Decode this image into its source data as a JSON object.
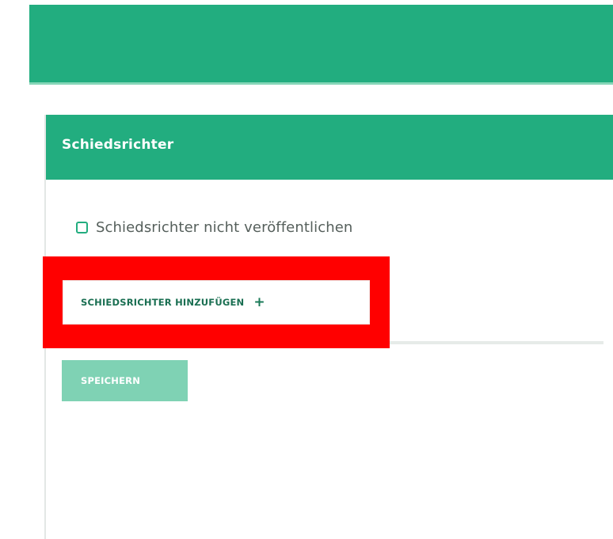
{
  "panel": {
    "title": "Schiedsrichter",
    "checkbox": {
      "label": "Schiedsrichter nicht veröffentlichen",
      "checked": false
    },
    "add_button": {
      "label": "SCHIEDSRICHTER HINZUFÜGEN",
      "icon": "plus-icon"
    },
    "save_button": {
      "label": "SPEICHERN",
      "disabled": true
    }
  },
  "colors": {
    "brand_green": "#22ad7f",
    "highlight_red": "#ff0000",
    "save_disabled": "#7fd2b4"
  }
}
